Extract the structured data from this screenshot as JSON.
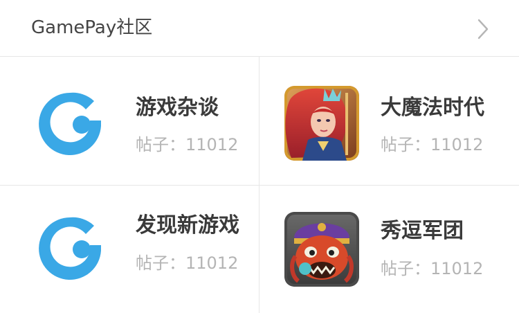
{
  "header": {
    "title": "GamePay社区",
    "chevron_icon": "chevron-right-icon"
  },
  "colors": {
    "brand_blue": "#3aa8e6",
    "title_text": "#3a3a3a",
    "count_text": "#b4b4b4",
    "divider": "#e6e6e6"
  },
  "communities": [
    {
      "title": "游戏杂谈",
      "count": "帖子：11012",
      "icon": "gamepay-logo-icon"
    },
    {
      "title": "大魔法时代",
      "count": "帖子：11012",
      "icon": "game-art-icon"
    },
    {
      "title": "发现新游戏",
      "count": "帖子：11012",
      "icon": "gamepay-logo-icon"
    },
    {
      "title": "秀逗军团",
      "count": "帖子：11012",
      "icon": "game-art-icon"
    }
  ]
}
